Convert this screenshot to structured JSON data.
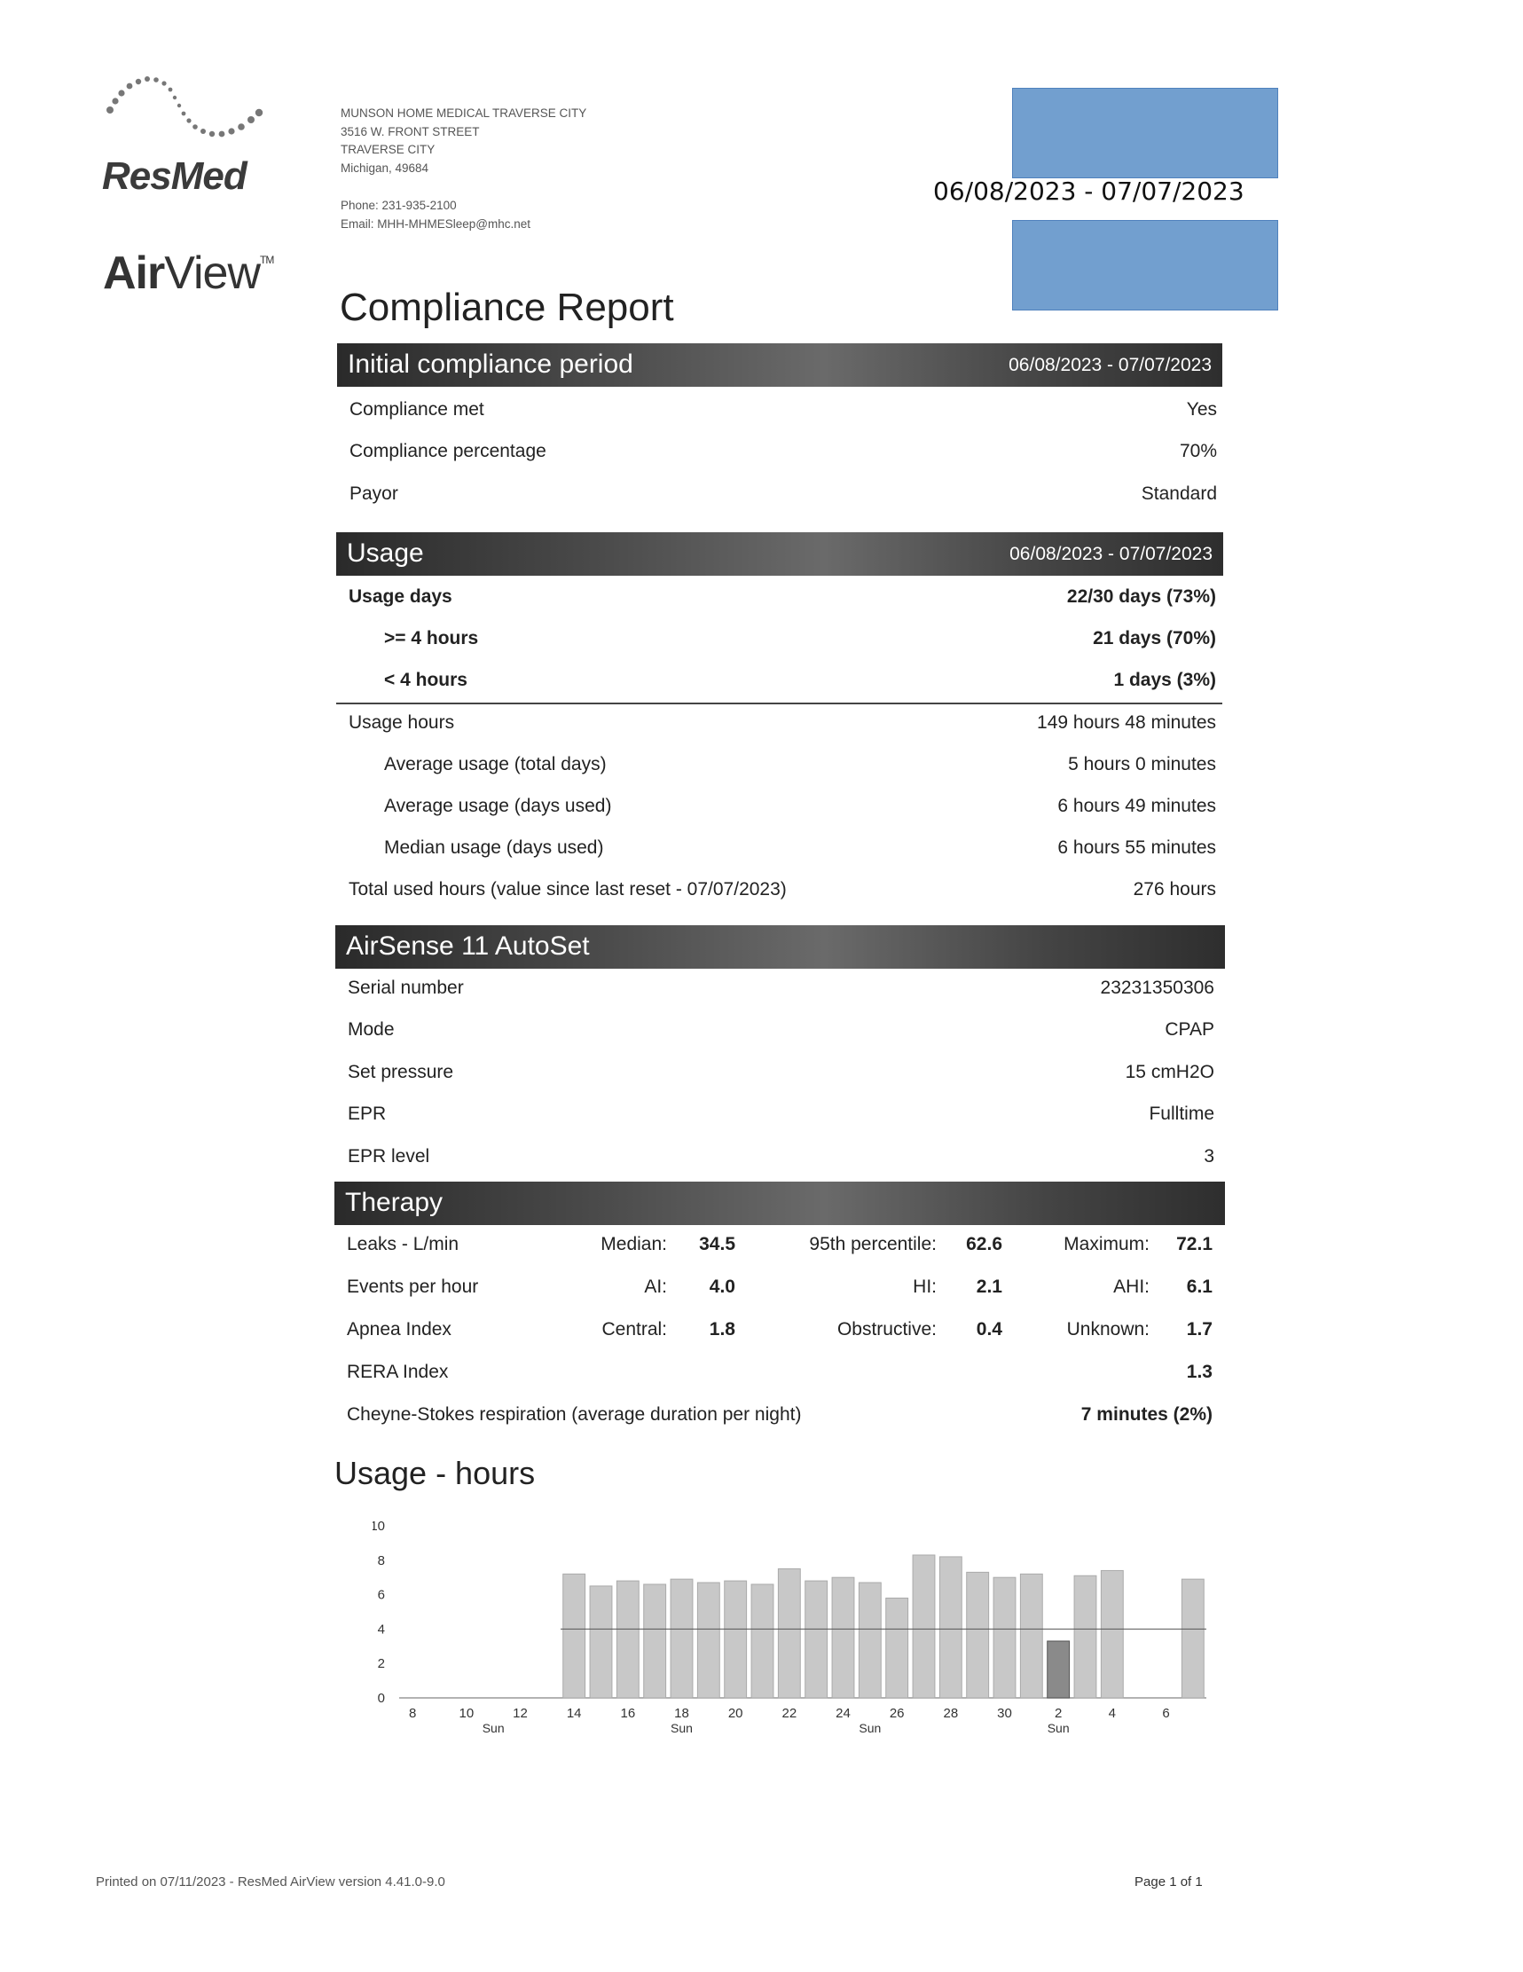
{
  "brand": {
    "company": "ResMed",
    "product_air": "Air",
    "product_view": "View",
    "tm": "TM"
  },
  "provider": {
    "name": "MUNSON HOME MEDICAL TRAVERSE CITY",
    "street": "3516 W. FRONT STREET",
    "city": "TRAVERSE CITY",
    "state_zip": "Michigan, 49684",
    "phone": "Phone: 231-935-2100",
    "email": "Email: MHH-MHMESleep@mhc.net"
  },
  "header": {
    "date_range": "06/08/2023 - 07/07/2023",
    "report_title": "Compliance Report"
  },
  "redaction_color": "#729fcf",
  "compliance": {
    "title": "Initial compliance period",
    "range": "06/08/2023 - 07/07/2023",
    "rows": [
      {
        "label": "Compliance met",
        "value": "Yes"
      },
      {
        "label": "Compliance percentage",
        "value": "70%"
      },
      {
        "label": "Payor",
        "value": "Standard"
      }
    ]
  },
  "usage": {
    "title": "Usage",
    "range": "06/08/2023 - 07/07/2023",
    "usage_days": {
      "label": "Usage days",
      "value": "22/30 days (73%)"
    },
    "ge4": {
      "label": ">= 4 hours",
      "value": "21 days (70%)"
    },
    "lt4": {
      "label": "< 4 hours",
      "value": "1 days (3%)"
    },
    "usage_hours": {
      "label": "Usage hours",
      "value": "149 hours 48 minutes"
    },
    "avg_total": {
      "label": "Average usage (total days)",
      "value": "5 hours 0 minutes"
    },
    "avg_used": {
      "label": "Average usage (days used)",
      "value": "6 hours 49 minutes"
    },
    "median_used": {
      "label": "Median usage (days used)",
      "value": "6 hours 55 minutes"
    },
    "total_used": {
      "label": "Total used hours (value since last reset - 07/07/2023)",
      "value": "276 hours"
    }
  },
  "device": {
    "title": "AirSense 11 AutoSet",
    "rows": [
      {
        "label": "Serial number",
        "value": "23231350306"
      },
      {
        "label": "Mode",
        "value": "CPAP"
      },
      {
        "label": "Set pressure",
        "value": "15 cmH2O"
      },
      {
        "label": "EPR",
        "value": "Fulltime"
      },
      {
        "label": "EPR level",
        "value": "3"
      }
    ]
  },
  "therapy": {
    "title": "Therapy",
    "leaks": {
      "label": "Leaks - L/min",
      "c1": "Median:",
      "v1": "34.5",
      "c2": "95th percentile:",
      "v2": "62.6",
      "c3": "Maximum:",
      "v3": "72.1"
    },
    "events": {
      "label": "Events per hour",
      "c1": "AI:",
      "v1": "4.0",
      "c2": "HI:",
      "v2": "2.1",
      "c3": "AHI:",
      "v3": "6.1"
    },
    "apnea": {
      "label": "Apnea Index",
      "c1": "Central:",
      "v1": "1.8",
      "c2": "Obstructive:",
      "v2": "0.4",
      "c3": "Unknown:",
      "v3": "1.7"
    },
    "rera": {
      "label": "RERA Index",
      "v3": "1.3"
    },
    "csr": {
      "label": "Cheyne-Stokes respiration (average duration per night)",
      "v3": "7 minutes (2%)"
    }
  },
  "chart_data": {
    "type": "bar",
    "title": "Usage - hours",
    "ylim": [
      0,
      10
    ],
    "y_ticks": [
      0,
      2,
      4,
      6,
      8,
      10
    ],
    "threshold": 4,
    "x_tick_labels": [
      "8",
      "10",
      "12",
      "14",
      "16",
      "18",
      "20",
      "22",
      "24",
      "26",
      "28",
      "30",
      "2",
      "4",
      "6"
    ],
    "x_sub_labels": [
      "Sun",
      "Sun",
      "Sun",
      "Sun"
    ],
    "categories": [
      "6/8",
      "6/9",
      "6/10",
      "6/11",
      "6/12",
      "6/13",
      "6/14",
      "6/15",
      "6/16",
      "6/17",
      "6/18",
      "6/19",
      "6/20",
      "6/21",
      "6/22",
      "6/23",
      "6/24",
      "6/25",
      "6/26",
      "6/27",
      "6/28",
      "6/29",
      "6/30",
      "7/1",
      "7/2",
      "7/3",
      "7/4",
      "7/5",
      "7/6",
      "7/7"
    ],
    "values": [
      0,
      0,
      0,
      0,
      0,
      0,
      7.2,
      6.5,
      6.8,
      6.6,
      6.9,
      6.7,
      6.8,
      6.6,
      7.5,
      6.8,
      7.0,
      6.7,
      5.8,
      8.3,
      8.2,
      7.3,
      7.0,
      7.2,
      3.3,
      7.1,
      7.4,
      0,
      0,
      6.9
    ],
    "bar_color": "#c8c8c8",
    "low_bar_color": "#8a8a8a"
  },
  "footer": {
    "printed": "Printed on 07/11/2023 - ResMed AirView version 4.41.0-9.0",
    "page": "Page 1 of 1"
  }
}
